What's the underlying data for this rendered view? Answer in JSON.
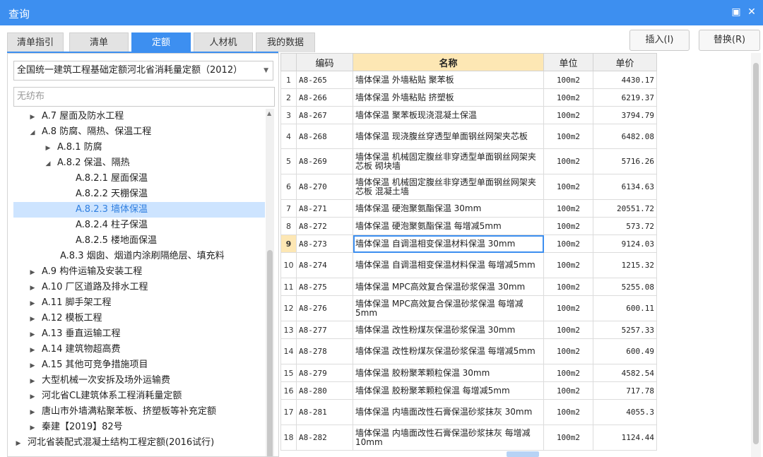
{
  "window": {
    "title": "查询",
    "restore_icon": "restore-icon",
    "close_icon": "close-icon"
  },
  "tabs": [
    {
      "label": "清单指引"
    },
    {
      "label": "清单"
    },
    {
      "label": "定额",
      "active": true
    },
    {
      "label": "人材机"
    },
    {
      "label": "我的数据"
    }
  ],
  "actions": {
    "insert": "插入(I)",
    "replace": "替换(R)"
  },
  "left": {
    "quota_library": "全国统一建筑工程基础定额河北省消耗量定额（2012）",
    "filter_value": "无纺布",
    "tree": [
      {
        "label": "A.7 屋面及防水工程",
        "level": 1,
        "arrow": "right"
      },
      {
        "label": "A.8 防腐、隔热、保温工程",
        "level": 1,
        "arrow": "down"
      },
      {
        "label": "A.8.1 防腐",
        "level": 2,
        "arrow": "right"
      },
      {
        "label": "A.8.2 保温、隔热",
        "level": 2,
        "arrow": "down"
      },
      {
        "label": "A.8.2.1 屋面保温",
        "level": 3,
        "arrow": ""
      },
      {
        "label": "A.8.2.2 天棚保温",
        "level": 3,
        "arrow": ""
      },
      {
        "label": "A.8.2.3 墙体保温",
        "level": 3,
        "arrow": "",
        "selected": true
      },
      {
        "label": "A.8.2.4 柱子保温",
        "level": 3,
        "arrow": ""
      },
      {
        "label": "A.8.2.5 楼地面保温",
        "level": 3,
        "arrow": ""
      },
      {
        "label": "A.8.3 烟囱、烟道内涂刷隔绝层、填充料",
        "level": 2,
        "arrow": ""
      },
      {
        "label": "A.9 构件运输及安装工程",
        "level": 1,
        "arrow": "right"
      },
      {
        "label": "A.10 厂区道路及排水工程",
        "level": 1,
        "arrow": "right"
      },
      {
        "label": "A.11 脚手架工程",
        "level": 1,
        "arrow": "right"
      },
      {
        "label": "A.12 模板工程",
        "level": 1,
        "arrow": "right"
      },
      {
        "label": "A.13 垂直运输工程",
        "level": 1,
        "arrow": "right"
      },
      {
        "label": "A.14 建筑物超高费",
        "level": 1,
        "arrow": "right"
      },
      {
        "label": "A.15 其他可竞争措施项目",
        "level": 1,
        "arrow": "right"
      },
      {
        "label": "大型机械一次安拆及场外运输费",
        "level": 1,
        "arrow": "right"
      },
      {
        "label": "河北省CL建筑体系工程消耗量定额",
        "level": 1,
        "arrow": "right"
      },
      {
        "label": "唐山市外墙满粘聚苯板、挤塑板等补充定额",
        "level": 1,
        "arrow": "right"
      },
      {
        "label": "秦建【2019】82号",
        "level": 1,
        "arrow": "right"
      },
      {
        "label": "河北省装配式混凝土结构工程定额(2016试行)",
        "level": 0,
        "arrow": "right"
      }
    ]
  },
  "table": {
    "headers": {
      "code": "编码",
      "name": "名称",
      "unit": "单位",
      "price": "单价"
    },
    "rows": [
      {
        "idx": "1",
        "code": "A8-265",
        "name": "墙体保温 外墙粘贴 聚苯板",
        "unit": "100m2",
        "price": "4430.17"
      },
      {
        "idx": "2",
        "code": "A8-266",
        "name": "墙体保温 外墙粘贴 挤塑板",
        "unit": "100m2",
        "price": "6219.37"
      },
      {
        "idx": "3",
        "code": "A8-267",
        "name": "墙体保温 聚苯板现浇混凝土保温",
        "unit": "100m2",
        "price": "3794.79"
      },
      {
        "idx": "4",
        "code": "A8-268",
        "name": "墙体保温 现浇腹丝穿透型单面钢丝网架夹芯板",
        "unit": "100m2",
        "price": "6482.08"
      },
      {
        "idx": "5",
        "code": "A8-269",
        "name": "墙体保温 机械固定腹丝非穿透型单面钢丝网架夹芯板 砌块墙",
        "unit": "100m2",
        "price": "5716.26"
      },
      {
        "idx": "6",
        "code": "A8-270",
        "name": "墙体保温 机械固定腹丝非穿透型单面钢丝网架夹芯板 混凝土墙",
        "unit": "100m2",
        "price": "6134.63"
      },
      {
        "idx": "7",
        "code": "A8-271",
        "name": "墙体保温 硬泡聚氨酯保温 30mm",
        "unit": "100m2",
        "price": "20551.72"
      },
      {
        "idx": "8",
        "code": "A8-272",
        "name": "墙体保温 硬泡聚氨酯保温 每增减5mm",
        "unit": "100m2",
        "price": "573.72"
      },
      {
        "idx": "9",
        "code": "A8-273",
        "name": "墙体保温 自调温相变保温材料保温 30mm",
        "unit": "100m2",
        "price": "9124.03",
        "current": true
      },
      {
        "idx": "10",
        "code": "A8-274",
        "name": "墙体保温 自调温相变保温材料保温 每增减5mm",
        "unit": "100m2",
        "price": "1215.32"
      },
      {
        "idx": "11",
        "code": "A8-275",
        "name": "墙体保温 MPC高效复合保温砂浆保温 30mm",
        "unit": "100m2",
        "price": "5255.08"
      },
      {
        "idx": "12",
        "code": "A8-276",
        "name": "墙体保温 MPC高效复合保温砂浆保温 每增减5mm",
        "unit": "100m2",
        "price": "600.11"
      },
      {
        "idx": "13",
        "code": "A8-277",
        "name": "墙体保温 改性粉煤灰保温砂浆保温 30mm",
        "unit": "100m2",
        "price": "5257.33"
      },
      {
        "idx": "14",
        "code": "A8-278",
        "name": "墙体保温 改性粉煤灰保温砂浆保温 每增减5mm",
        "unit": "100m2",
        "price": "600.49"
      },
      {
        "idx": "15",
        "code": "A8-279",
        "name": "墙体保温 胶粉聚苯颗粒保温 30mm",
        "unit": "100m2",
        "price": "4582.54"
      },
      {
        "idx": "16",
        "code": "A8-280",
        "name": "墙体保温 胶粉聚苯颗粒保温 每增减5mm",
        "unit": "100m2",
        "price": "717.78"
      },
      {
        "idx": "17",
        "code": "A8-281",
        "name": "墙体保温 内墙面改性石膏保温砂浆抹灰 30mm",
        "unit": "100m2",
        "price": "4055.3"
      },
      {
        "idx": "18",
        "code": "A8-282",
        "name": "墙体保温 内墙面改性石膏保温砂浆抹灰 每增减10mm",
        "unit": "100m2",
        "price": "1124.44"
      }
    ]
  }
}
